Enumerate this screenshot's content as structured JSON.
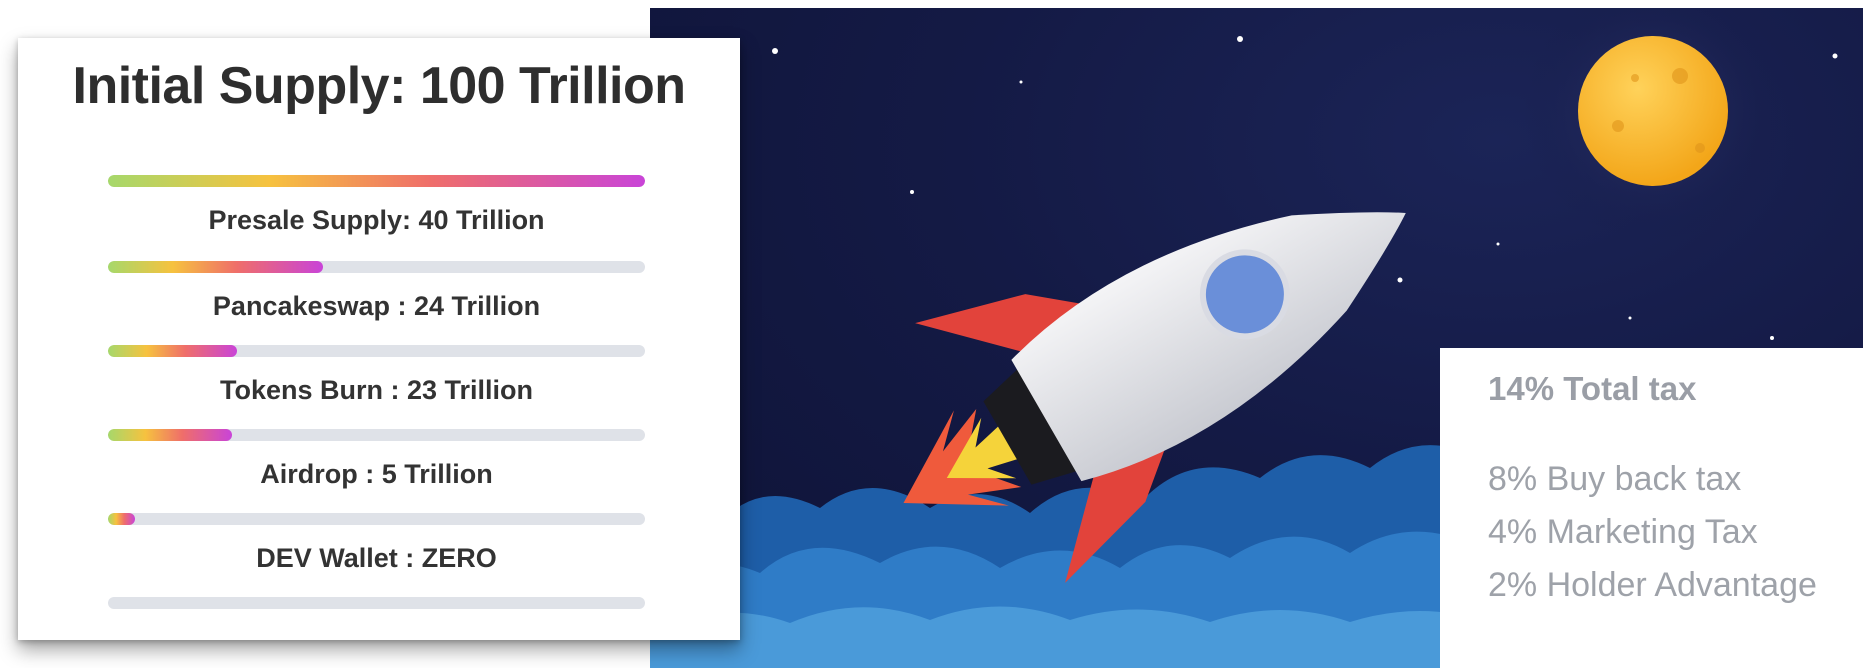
{
  "supply": {
    "title": "Initial Supply: 100 Trillion",
    "items": [
      {
        "label": "Presale Supply: 40 Trillion",
        "progress": 1.0
      },
      {
        "label": "Pancakeswap : 24 Trillion",
        "progress": 0.4
      },
      {
        "label": "Tokens Burn : 23 Trillion",
        "progress": 0.24
      },
      {
        "label": "Airdrop : 5 Trillion",
        "progress": 0.23
      },
      {
        "label": "DEV Wallet : ZERO",
        "progress": 0.05
      },
      {
        "label": "",
        "progress": 0.0
      }
    ]
  },
  "tax": {
    "total": "14% Total tax",
    "lines": [
      "8% Buy back tax",
      "4% Marketing Tax",
      "2% Holder Advantage"
    ]
  },
  "colors": {
    "bar_gradient": [
      "#a6d86b",
      "#f6c23f",
      "#ef6e6a",
      "#c944d8"
    ],
    "track": "#dfe2e8",
    "sky": "#141a45",
    "moon": "#f7b52c",
    "cloud": "#2e78c4"
  },
  "scene": {
    "icons": [
      "rocket-icon",
      "moon-icon",
      "cloud-icon",
      "star-icon"
    ]
  }
}
